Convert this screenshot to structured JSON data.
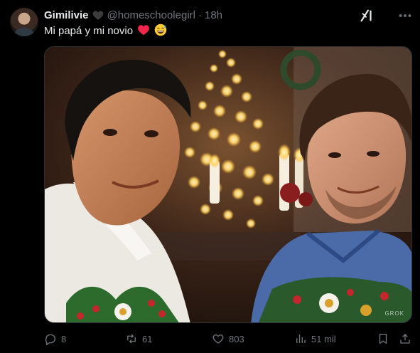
{
  "post": {
    "display_name": "Gimilivie",
    "handle": "@homeschoolegirl",
    "separator": "·",
    "time": "18h",
    "text": "Mi papá y mi novio",
    "emojis": [
      "heart-red-emoji",
      "laughing-sweat-emoji"
    ]
  },
  "media": {
    "description_icon": "photo-of-two-men-in-christmas-sweaters",
    "watermark": "GROK"
  },
  "actions": {
    "replies": "8",
    "reposts": "61",
    "likes": "803",
    "views": "51 mil"
  },
  "colors": {
    "background": "#000000",
    "text_primary": "#e7e9ea",
    "text_secondary": "#71767b",
    "border": "#2f3336"
  }
}
